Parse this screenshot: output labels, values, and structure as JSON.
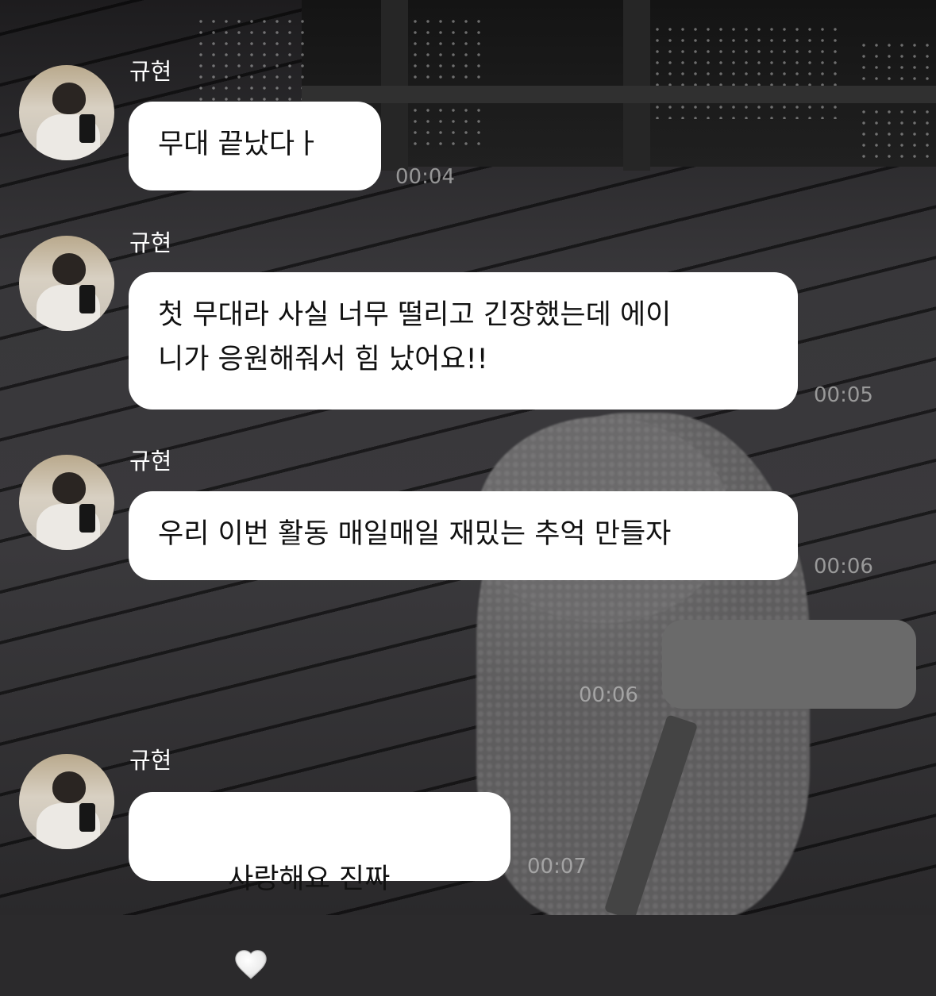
{
  "sender_name": "규현",
  "messages": [
    {
      "sender": "규현",
      "text": "무대 끝났다ㅏ",
      "time": "00:04"
    },
    {
      "sender": "규현",
      "text": "첫 무대라 사실 너무 떨리고 긴장했는데 에이\n니가 응원해줘서 힘 났어요!!",
      "time": "00:05"
    },
    {
      "sender": "규현",
      "text": "우리 이번 활동 매일매일 재밌는 추억 만들자",
      "time": "00:06"
    },
    {
      "sender": "me",
      "text": "",
      "time": "00:06"
    },
    {
      "sender": "규현",
      "text": "사랑해요 진짜",
      "time": "00:07",
      "icon": "white-heart-icon"
    }
  ],
  "colors": {
    "bubble_incoming": "#ffffff",
    "bubble_outgoing": "#6a6a6a",
    "name_text": "#ffffff",
    "time_text": "#b9b9b9"
  }
}
